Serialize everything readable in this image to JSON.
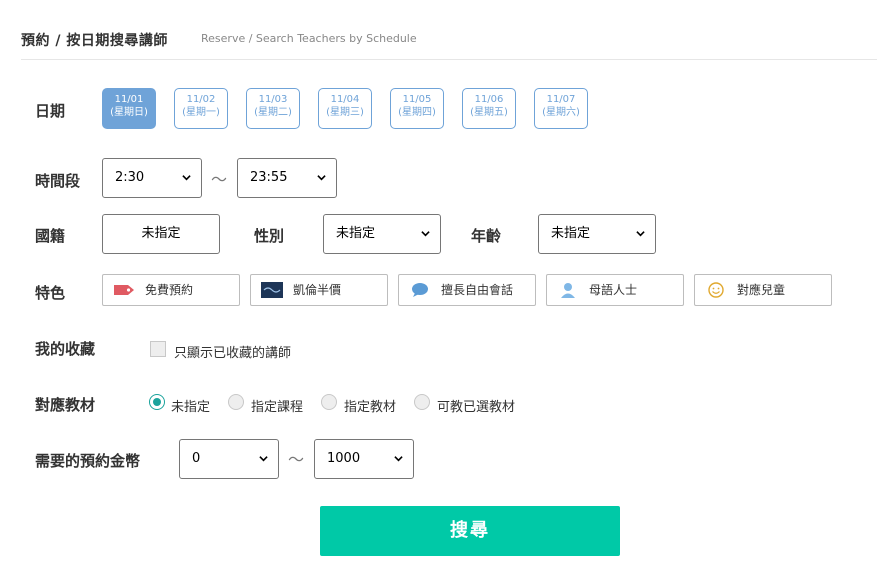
{
  "header": {
    "title": "預約 / 按日期搜尋講師",
    "subtitle": "Reserve / Search Teachers by Schedule"
  },
  "labels": {
    "date": "日期",
    "time": "時間段",
    "nationality": "國籍",
    "gender": "性別",
    "age": "年齡",
    "features": "特色",
    "favorites": "我的收藏",
    "materials": "對應教材",
    "points": "需要的預約金幣"
  },
  "dates": [
    {
      "date": "11/01",
      "weekday": "(星期日)",
      "active": true
    },
    {
      "date": "11/02",
      "weekday": "(星期一)",
      "active": false
    },
    {
      "date": "11/03",
      "weekday": "(星期二)",
      "active": false
    },
    {
      "date": "11/04",
      "weekday": "(星期三)",
      "active": false
    },
    {
      "date": "11/05",
      "weekday": "(星期四)",
      "active": false
    },
    {
      "date": "11/06",
      "weekday": "(星期五)",
      "active": false
    },
    {
      "date": "11/07",
      "weekday": "(星期六)",
      "active": false
    }
  ],
  "time": {
    "start": "2:30",
    "end": "23:55",
    "separator": "～"
  },
  "nationality": {
    "value": "未指定"
  },
  "gender": {
    "value": "未指定"
  },
  "age": {
    "value": "未指定"
  },
  "features": [
    {
      "label": "免費預約",
      "icon": "tag-icon"
    },
    {
      "label": "凱倫半價",
      "icon": "banner-icon"
    },
    {
      "label": "擅長自由會話",
      "icon": "speech-bubble-icon"
    },
    {
      "label": "母語人士",
      "icon": "person-icon"
    },
    {
      "label": "對應兒童",
      "icon": "smiley-icon"
    }
  ],
  "favorites": {
    "checkbox_label": "只顯示已收藏的講師",
    "checked": false
  },
  "materials": {
    "options": [
      "未指定",
      "指定課程",
      "指定教材",
      "可教已選教材"
    ],
    "selected": 0
  },
  "points": {
    "min": "0",
    "max": "1000",
    "separator": "～"
  },
  "search_button": "搜尋",
  "colors": {
    "accent_blue": "#6fa3d8",
    "search_green": "#00c9a7",
    "radio_teal": "#1ba39c"
  }
}
